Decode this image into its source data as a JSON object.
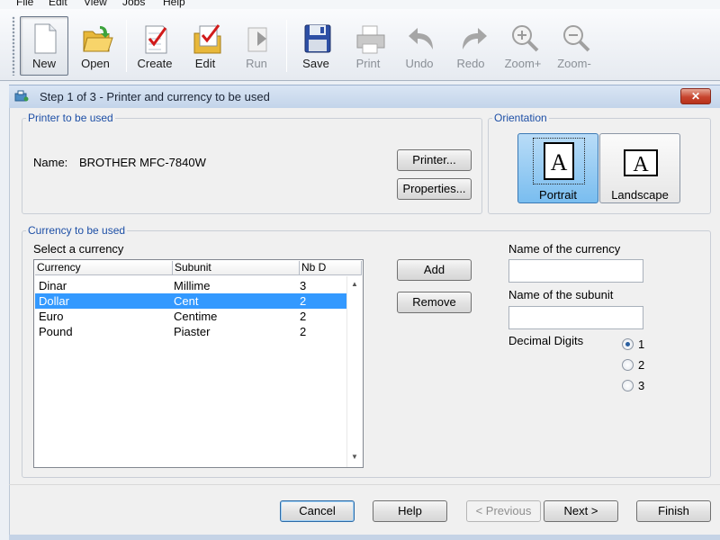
{
  "menu": [
    "File",
    "Edit",
    "View",
    "Jobs",
    "Help"
  ],
  "toolbar": [
    {
      "label": "New",
      "icon": "new-document-icon",
      "state": "pressed"
    },
    {
      "label": "Open",
      "icon": "open-folder-icon",
      "state": "enabled"
    },
    {
      "label": "Create",
      "icon": "create-checklist-icon",
      "state": "enabled"
    },
    {
      "label": "Edit",
      "icon": "edit-checklist-icon",
      "state": "enabled"
    },
    {
      "label": "Run",
      "icon": "run-icon",
      "state": "disabled"
    },
    {
      "label": "Save",
      "icon": "floppy-disk-icon",
      "state": "enabled"
    },
    {
      "label": "Print",
      "icon": "printer-icon",
      "state": "disabled"
    },
    {
      "label": "Undo",
      "icon": "undo-icon",
      "state": "disabled"
    },
    {
      "label": "Redo",
      "icon": "redo-icon",
      "state": "disabled"
    },
    {
      "label": "Zoom+",
      "icon": "zoom-in-icon",
      "state": "disabled"
    },
    {
      "label": "Zoom-",
      "icon": "zoom-out-icon",
      "state": "disabled"
    }
  ],
  "dialog": {
    "title": "Step 1 of 3 - Printer and currency to be used",
    "close_glyph": "✕",
    "printer_group": {
      "legend": "Printer to be used",
      "name_label": "Name:",
      "name_value": "BROTHER MFC-7840W",
      "printer_button": "Printer...",
      "properties_button": "Properties..."
    },
    "orientation_group": {
      "legend": "Orientation",
      "options": [
        {
          "label": "Portrait",
          "glyph": "A",
          "selected": true
        },
        {
          "label": "Landscape",
          "glyph": "A",
          "selected": false
        }
      ]
    },
    "currency_group": {
      "legend": "Currency to be used",
      "select_label": "Select a currency",
      "columns": [
        "Currency",
        "Subunit",
        "Nb D"
      ],
      "rows": [
        {
          "currency": "Dinar",
          "subunit": "Millime",
          "digits": "3",
          "selected": false
        },
        {
          "currency": "Dollar",
          "subunit": "Cent",
          "digits": "2",
          "selected": true
        },
        {
          "currency": "Euro",
          "subunit": "Centime",
          "digits": "2",
          "selected": false
        },
        {
          "currency": "Pound",
          "subunit": "Piaster",
          "digits": "2",
          "selected": false
        }
      ],
      "add_button": "Add",
      "remove_button": "Remove",
      "currency_name_label": "Name of the currency",
      "currency_name_value": "",
      "subunit_name_label": "Name of the subunit",
      "subunit_name_value": "",
      "decimal_label": "Decimal Digits",
      "decimal_options": [
        "1",
        "2",
        "3"
      ],
      "decimal_selected": "1"
    },
    "buttons": {
      "cancel": "Cancel",
      "help": "Help",
      "previous": "< Previous",
      "next": "Next >",
      "finish": "Finish"
    }
  },
  "colors": {
    "accent_selection": "#3399ff",
    "group_legend": "#1d4fa6",
    "close_button": "#c7452e",
    "orientation_selected": "#79bdef"
  }
}
